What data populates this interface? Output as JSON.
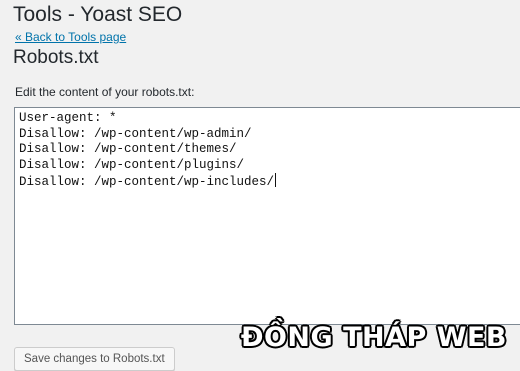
{
  "header": {
    "title": "Tools - Yoast SEO",
    "back_link": "« Back to Tools page"
  },
  "section": {
    "title": "Robots.txt",
    "label": "Edit the content of your robots.txt:"
  },
  "editor": {
    "lines": [
      "User-agent: *",
      "Disallow: /wp-content/wp-admin/",
      "Disallow: /wp-content/themes/",
      "Disallow: /wp-content/plugins/",
      "Disallow: /wp-content/wp-includes/"
    ]
  },
  "actions": {
    "save_label": "Save changes to Robots.txt"
  },
  "watermark": {
    "text": "ĐỒNG THÁP WEB"
  },
  "colors": {
    "link": "#0073aa",
    "background": "#f1f1f1"
  }
}
